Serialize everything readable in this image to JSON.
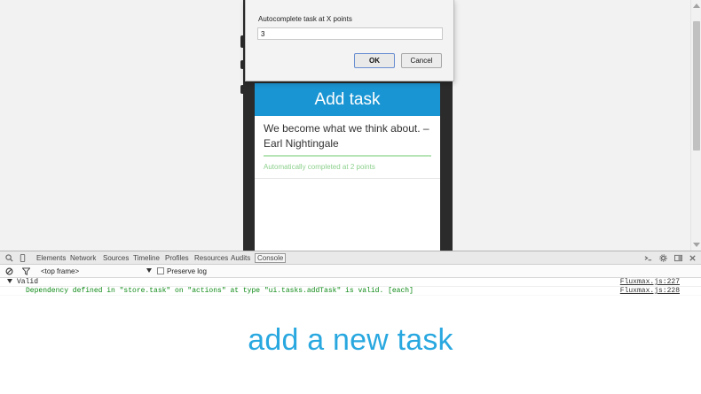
{
  "dialog": {
    "prompt_label": "Autocomplete task at X points",
    "input_value": "3",
    "ok_label": "OK",
    "cancel_label": "Cancel"
  },
  "app": {
    "header_title": "Add task",
    "task_text": "We become what we think about. –Earl Nightingale",
    "task_status": "Automatically completed at 2 points"
  },
  "devtools": {
    "tabs": [
      "Elements",
      "Network",
      "Sources",
      "Timeline",
      "Profiles",
      "Resources",
      "Audits",
      "Console"
    ],
    "active_tab": "Console",
    "frame_select": "<top frame>",
    "preserve_log_label": "Preserve log",
    "logs": [
      {
        "text": "Valid",
        "source": "Fluxmax.js:227"
      },
      {
        "text": "Dependency defined in \"store.task\" on \"actions\" at type \"ui.tasks.addTask\" is valid. [each]",
        "source": "Fluxmax.js:228"
      }
    ]
  },
  "caption": "add a new task",
  "colors": {
    "header_blue": "#1a95d3",
    "caption_blue": "#29a8e0",
    "log_green": "#0e8a16",
    "status_green": "#8dd08d"
  }
}
